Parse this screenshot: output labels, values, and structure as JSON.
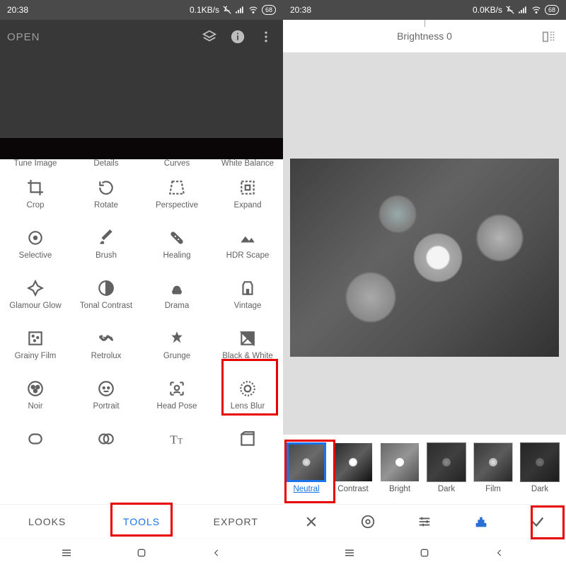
{
  "status": {
    "time": "20:38",
    "net_left": "0.1KB/s",
    "net_right": "0.0KB/s",
    "battery": "68"
  },
  "left": {
    "top": {
      "open": "OPEN"
    },
    "tools": {
      "row0": [
        "Tune Image",
        "Details",
        "Curves",
        "White Balance"
      ],
      "row1": [
        "Crop",
        "Rotate",
        "Perspective",
        "Expand"
      ],
      "row2": [
        "Selective",
        "Brush",
        "Healing",
        "HDR Scape"
      ],
      "row3": [
        "Glamour Glow",
        "Tonal Contrast",
        "Drama",
        "Vintage"
      ],
      "row4": [
        "Grainy Film",
        "Retrolux",
        "Grunge",
        "Black & White"
      ],
      "row5": [
        "Noir",
        "Portrait",
        "Head Pose",
        "Lens Blur"
      ]
    },
    "tabs": {
      "looks": "LOOKS",
      "tools": "TOOLS",
      "export": "EXPORT"
    }
  },
  "right": {
    "header": {
      "label": "Brightness",
      "value": "0"
    },
    "presets": [
      "Neutral",
      "Contrast",
      "Bright",
      "Dark",
      "Film",
      "Dark"
    ]
  }
}
